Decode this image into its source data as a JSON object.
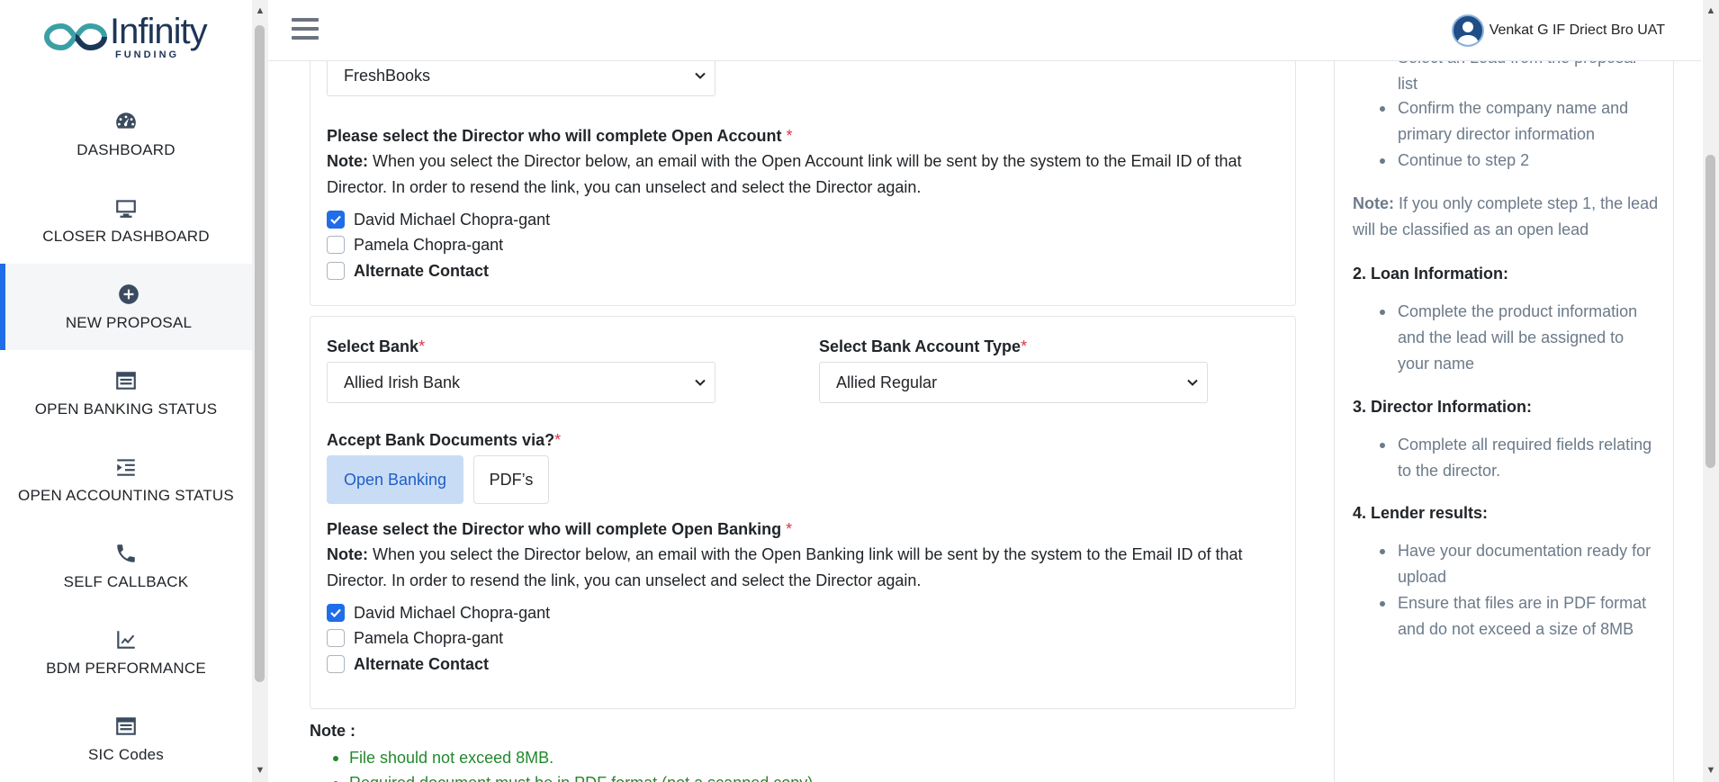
{
  "logo": {
    "name": "Infinity",
    "sub": "FUNDING"
  },
  "sidebar": {
    "items": [
      {
        "label": "DASHBOARD",
        "icon": "dashboard-icon"
      },
      {
        "label": "CLOSER DASHBOARD",
        "icon": "monitor-icon"
      },
      {
        "label": "NEW PROPOSAL",
        "icon": "plus-circle-icon",
        "active": true
      },
      {
        "label": "OPEN BANKING STATUS",
        "icon": "list-window-icon"
      },
      {
        "label": "OPEN ACCOUNTING STATUS",
        "icon": "indent-list-icon"
      },
      {
        "label": "SELF CALLBACK",
        "icon": "phone-icon"
      },
      {
        "label": "BDM PERFORMANCE",
        "icon": "trend-chart-icon"
      },
      {
        "label": "SIC Codes",
        "icon": "list-window-icon"
      }
    ]
  },
  "header": {
    "user_name": "Venkat G IF Driect Bro UAT"
  },
  "accounting": {
    "software_value": "FreshBooks",
    "director_label": "Please select the Director who will complete Open Account",
    "note_label": "Note:",
    "note_text": "When you select the Director below, an email with the Open Account link will be sent by the system to the Email ID of that Director. In order to resend the link, you can unselect and select the Director again.",
    "directors": [
      {
        "name": "David Michael Chopra-gant",
        "checked": true,
        "bold": false
      },
      {
        "name": "Pamela Chopra-gant",
        "checked": false,
        "bold": false
      },
      {
        "name": "Alternate Contact",
        "checked": false,
        "bold": true
      }
    ]
  },
  "banking": {
    "bank_label": "Select Bank",
    "bank_value": "Allied Irish Bank",
    "account_type_label": "Select Bank Account Type",
    "account_type_value": "Allied Regular",
    "accept_label": "Accept Bank Documents via?",
    "option_open_banking": "Open Banking",
    "option_pdfs": "PDF’s",
    "director_label": "Please select the Director who will complete Open Banking",
    "note_label": "Note:",
    "note_text": "When you select the Director below, an email with the Open Banking link will be sent by the system to the Email ID of that Director. In order to resend the link, you can unselect and select the Director again.",
    "directors": [
      {
        "name": "David Michael Chopra-gant",
        "checked": true,
        "bold": false
      },
      {
        "name": "Pamela Chopra-gant",
        "checked": false,
        "bold": false
      },
      {
        "name": "Alternate Contact",
        "checked": false,
        "bold": true
      }
    ],
    "required_mark": "*"
  },
  "bottom_note": {
    "title": "Note :",
    "items": [
      "File should not exceed 8MB.",
      "Required document must be in PDF format (not a scanned copy)."
    ]
  },
  "guide": {
    "step1_items": [
      "Select an Lead from the proposal list",
      "Confirm the company name and primary director information",
      "Continue to step 2"
    ],
    "note_label": "Note:",
    "note_text": "If you only complete step 1, the lead will be classified as an open lead",
    "step2_heading": "2. Loan Information:",
    "step2_items": [
      "Complete the product information and the lead will be assigned to your name"
    ],
    "step3_heading": "3. Director Information:",
    "step3_items": [
      "Complete all required fields relating to the director."
    ],
    "step4_heading": "4. Lender results:",
    "step4_items": [
      "Have your documentation ready for upload",
      "Ensure that files are in PDF format and do not exceed a size of 8MB"
    ]
  },
  "colors": {
    "accent": "#1f6ee8",
    "success": "#23892d",
    "required": "#dc3545"
  }
}
